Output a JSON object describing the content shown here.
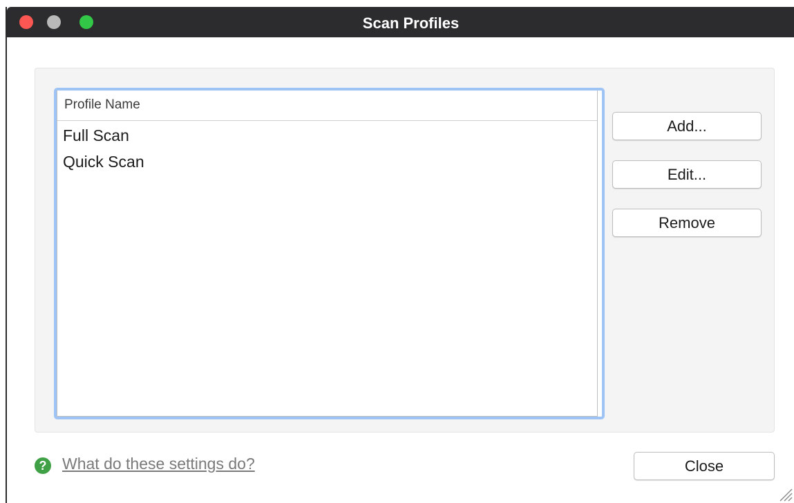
{
  "window": {
    "title": "Scan Profiles",
    "colors": {
      "titlebar": "#2c2c2e",
      "close": "#fc5753",
      "minimize": "#b9b9b9",
      "zoom": "#33c748",
      "list_focus_ring": "#9ec3f5",
      "help_icon": "#3fa046"
    }
  },
  "profiles": {
    "column_header": "Profile Name",
    "items": [
      "Full Scan",
      "Quick Scan"
    ]
  },
  "actions": {
    "add_label": "Add...",
    "edit_label": "Edit...",
    "remove_label": "Remove"
  },
  "footer": {
    "help_icon": "question-icon",
    "help_icon_glyph": "?",
    "help_link": "What do these settings do?",
    "close_label": "Close"
  }
}
